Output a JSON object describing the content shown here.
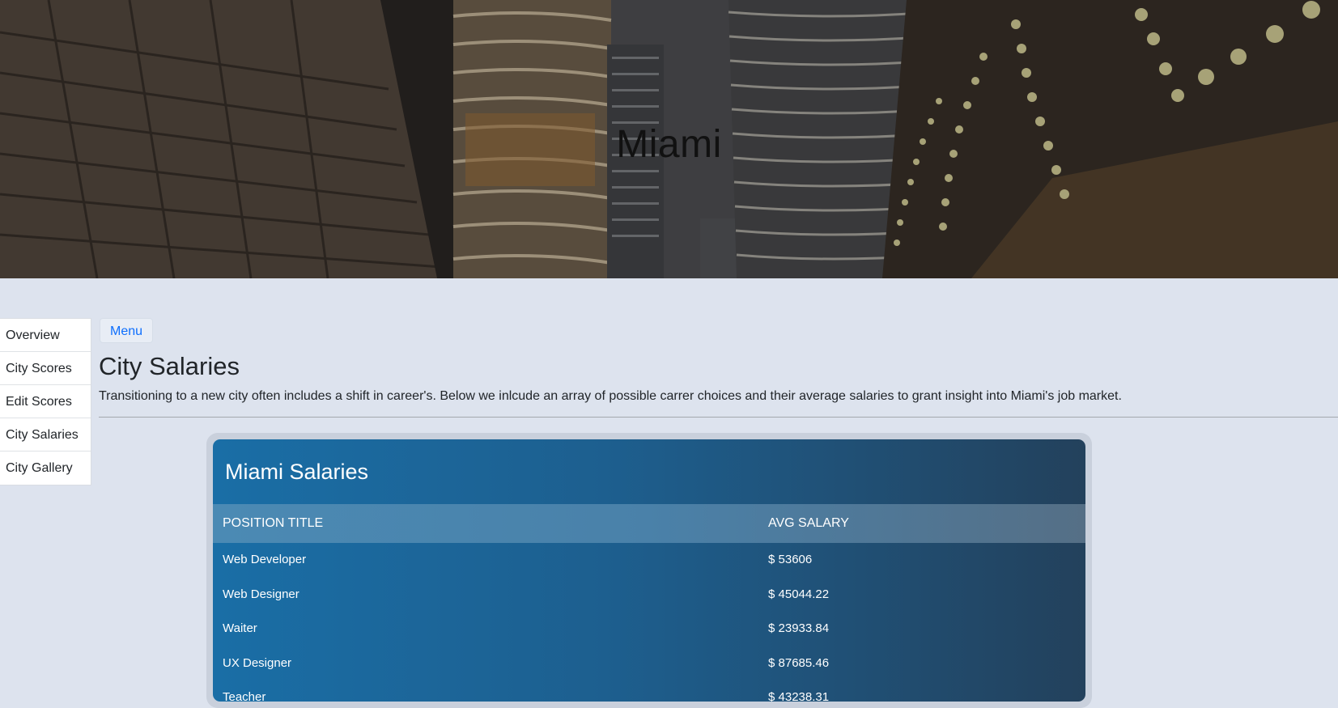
{
  "hero": {
    "city_title": "Miami"
  },
  "sidebar": {
    "items": [
      {
        "label": "Overview"
      },
      {
        "label": "City Scores"
      },
      {
        "label": "Edit Scores"
      },
      {
        "label": "City Salaries"
      },
      {
        "label": "City Gallery"
      }
    ]
  },
  "main": {
    "menu_label": "Menu",
    "title": "City Salaries",
    "description": "Transitioning to a new city often includes a shift in career's. Below we inlcude an array of possible carrer choices and their average salaries to grant insight into Miami's job market."
  },
  "salaries": {
    "title": "Miami Salaries",
    "headers": {
      "position": "POSITION TITLE",
      "salary": "AVG SALARY"
    },
    "rows": [
      {
        "position": "Web Developer",
        "salary": "$ 53606"
      },
      {
        "position": "Web Designer",
        "salary": "$ 45044.22"
      },
      {
        "position": "Waiter",
        "salary": "$ 23933.84"
      },
      {
        "position": "UX Designer",
        "salary": "$ 87685.46"
      },
      {
        "position": "Teacher",
        "salary": "$ 43238.31"
      }
    ]
  }
}
